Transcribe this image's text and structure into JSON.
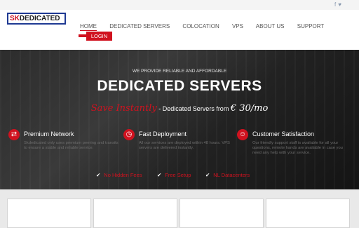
{
  "social": {
    "icons": [
      "facebook-icon",
      "twitter-icon"
    ],
    "glyphs": "f ♥"
  },
  "logo": {
    "accent": "SK",
    "rest": "DEDICATED"
  },
  "nav": {
    "items": [
      "HOME",
      "DEDICATED SERVERS",
      "COLOCATION",
      "VPS",
      "ABOUT US",
      "SUPPORT"
    ],
    "login": "LOGIN"
  },
  "hero": {
    "tagline": "WE PROVIDE RELIABLE AND AFFORDABLE",
    "headline": "DEDICATED SERVERS",
    "save": "Save Instantly",
    "middle": " - Dedicated Servers from ",
    "price": "€ 30/mo"
  },
  "features": [
    {
      "title": "Premium Network",
      "desc": "Skdedicated only uses premium peering and transits to ensure a stable and reliable service."
    },
    {
      "title": "Fast Deployment",
      "desc": "All our services are deployed within 48 hours. VPS servers are delivered instantly."
    },
    {
      "title": "Customer Satisfaction",
      "desc": "Our friendly support staff is available for all your questions, remote hands are available in case you need any help with your service."
    }
  ],
  "checks": [
    "No Hidden Fees",
    "Free Setup",
    "NL Datacenters"
  ],
  "colors": {
    "accent": "#d0121f",
    "logo_border": "#1f3a93"
  }
}
